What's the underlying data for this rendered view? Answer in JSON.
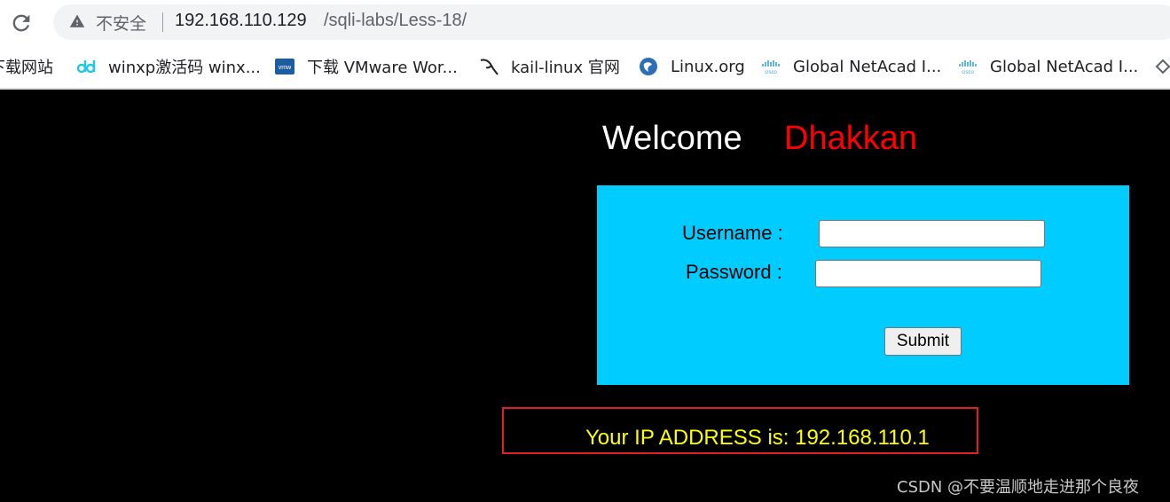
{
  "browser": {
    "security_label": "不安全",
    "url_host": "192.168.110.129",
    "url_path": "/sqli-labs/Less-18/"
  },
  "bookmarks": [
    {
      "label": "下载网站",
      "icon": "none"
    },
    {
      "label": "winxp激活码 winx...",
      "icon": "dd-logo-icon"
    },
    {
      "label": "下载 VMware Wor...",
      "icon": "vmware-icon"
    },
    {
      "label": "kail-linux 官网",
      "icon": "kali-dragon-icon"
    },
    {
      "label": "Linux.org",
      "icon": "linux-org-icon"
    },
    {
      "label": "Global NetAcad I...",
      "icon": "cisco-icon"
    },
    {
      "label": "Global NetAcad I...",
      "icon": "cisco-icon"
    }
  ],
  "page": {
    "welcome": "Welcome",
    "name": "Dhakkan",
    "username_label": "Username :",
    "password_label": "Password :",
    "username_value": "",
    "password_value": "",
    "submit_label": "Submit",
    "ip_message": "Your IP ADDRESS is: 192.168.110.1",
    "watermark": "CSDN @不要温顺地走进那个良夜"
  },
  "colors": {
    "background": "#000000",
    "form_bg": "#00ccff",
    "welcome_name": "#ff0000",
    "ip_text": "#ffff00",
    "highlight_box": "#e02020"
  }
}
